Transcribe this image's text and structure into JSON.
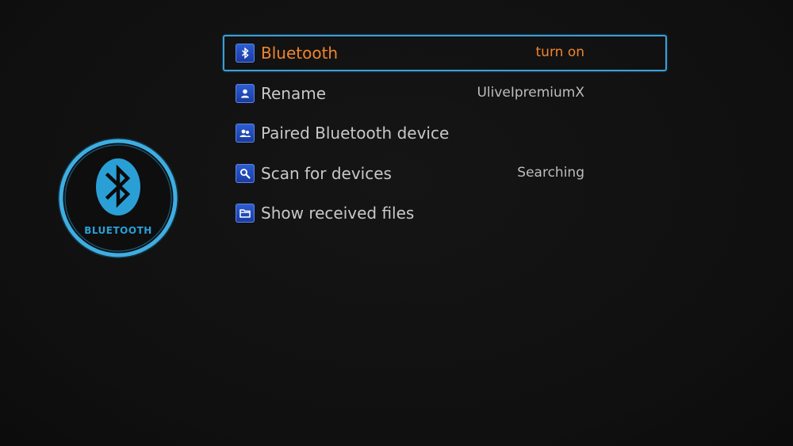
{
  "badge": {
    "label": "BLUETOOTH",
    "icon": "bluetooth-icon",
    "accent_color": "#2a9fd6"
  },
  "menu": {
    "selected_color": "#f0852d",
    "highlight_border_color": "#3aa0d8",
    "items": [
      {
        "label": "Bluetooth",
        "value": "turn on",
        "icon": "bluetooth-icon",
        "selected": true
      },
      {
        "label": "Rename",
        "value": "UliveIpremiumX",
        "icon": "person-icon",
        "selected": false
      },
      {
        "label": "Paired Bluetooth device",
        "value": "",
        "icon": "people-icon",
        "selected": false
      },
      {
        "label": "Scan for devices",
        "value": "Searching",
        "icon": "search-icon",
        "selected": false
      },
      {
        "label": "Show received files",
        "value": "",
        "icon": "folder-icon",
        "selected": false
      }
    ]
  }
}
